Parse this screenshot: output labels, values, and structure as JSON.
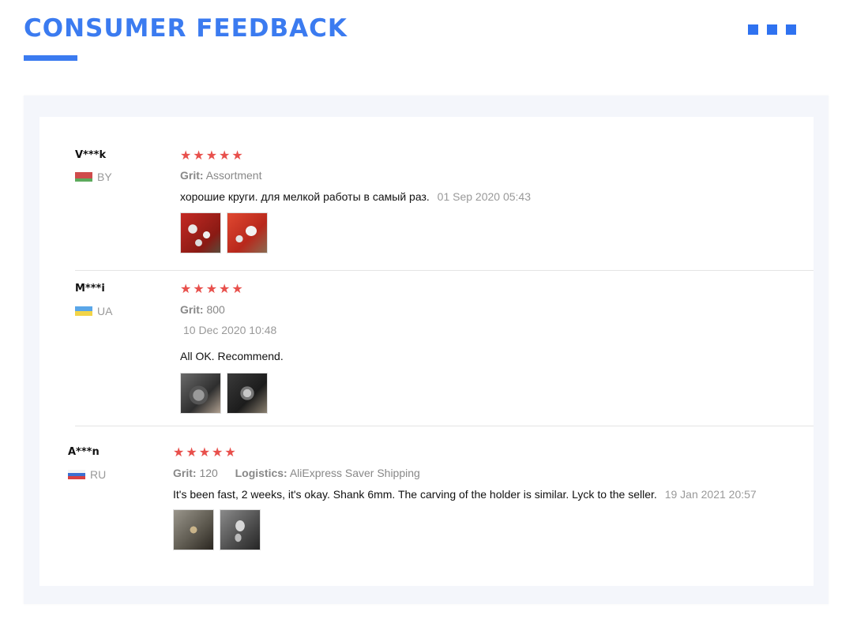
{
  "header": {
    "title": "CONSUMER FEEDBACK"
  },
  "colors": {
    "accent": "#3b7bf0",
    "star": "#e8504c",
    "panel": "#f4f6fb"
  },
  "reviews": [
    {
      "name": "V***k",
      "country": "BY",
      "flag_icon": "flag-belarus-icon",
      "stars": 5,
      "star_glyph": "★",
      "meta": [
        {
          "label": "Grit:",
          "value": "Assortment"
        }
      ],
      "text": "хорошие круги. для мелкой работы в самый раз.",
      "date": "01 Sep 2020 05:43",
      "photos": [
        "red-tray-photo",
        "red-tray-photo"
      ]
    },
    {
      "name": "M***i",
      "country": "UA",
      "flag_icon": "flag-ukraine-icon",
      "stars": 5,
      "star_glyph": "★",
      "meta": [
        {
          "label": "Grit:",
          "value": "800"
        }
      ],
      "date": "10 Dec 2020 10:48",
      "text": "All OK. Recommend.",
      "photos": [
        "polishing-photo",
        "polishing-photo"
      ]
    },
    {
      "name": "A***n",
      "country": "RU",
      "flag_icon": "flag-russia-icon",
      "stars": 5,
      "star_glyph": "★",
      "meta": [
        {
          "label": "Grit:",
          "value": "120"
        },
        {
          "label": "Logistics:",
          "value": "AliExpress Saver Shipping"
        }
      ],
      "text": "It's been fast, 2 weeks, it's okay. Shank 6mm. The carving of the holder is similar. Lyck to the seller.",
      "date": "19 Jan 2021 20:57",
      "photos": [
        "package-photo",
        "package-photo"
      ]
    }
  ]
}
